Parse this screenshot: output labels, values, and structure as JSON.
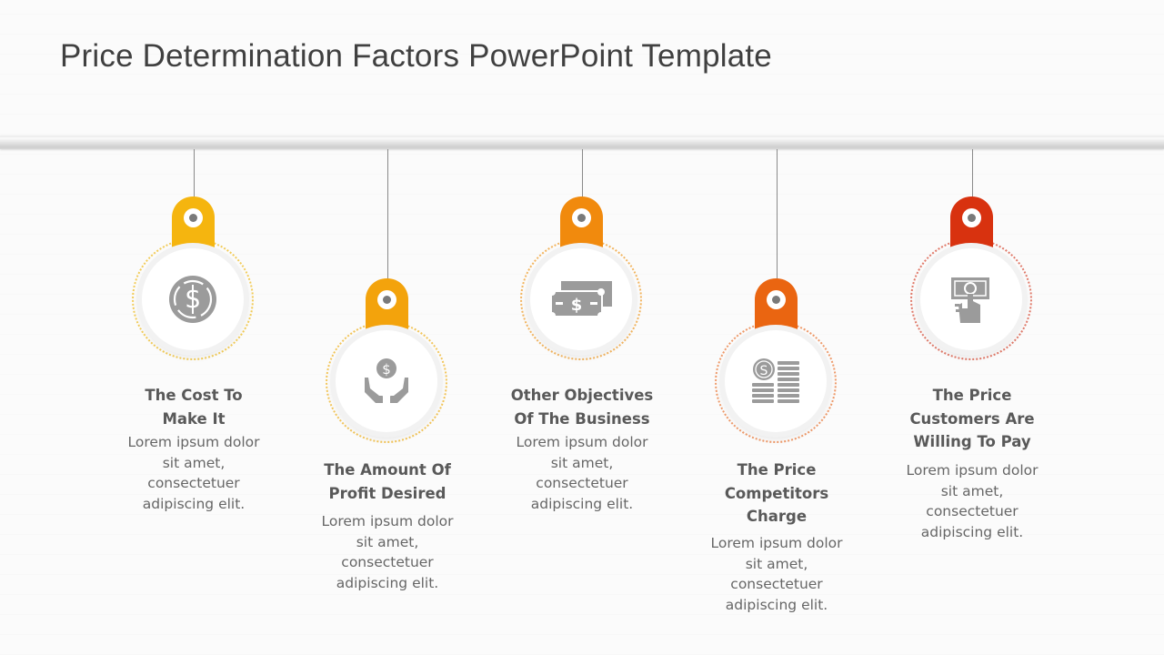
{
  "title": "Price Determination Factors PowerPoint Template",
  "factors": [
    {
      "heading": "The Cost To Make It",
      "heading_lines": [
        "The Cost To",
        "Make It"
      ],
      "body_lines": [
        "Lorem ipsum dolor",
        "sit amet,",
        "consectetuer",
        "adipiscing elit."
      ],
      "color": "#F5B50F",
      "ring_color": "#F2CC5A",
      "icon": "dollar-coin-icon"
    },
    {
      "heading": "The Amount Of Profit Desired",
      "heading_lines": [
        "The Amount Of",
        "Profit Desired"
      ],
      "body_lines": [
        "Lorem ipsum dolor",
        "sit amet,",
        "consectetuer",
        "adipiscing elit."
      ],
      "color": "#F3A30C",
      "ring_color": "#F2C55A",
      "icon": "hands-holding-coin-icon"
    },
    {
      "heading": "Other Objectives Of The Business",
      "heading_lines": [
        "Other Objectives",
        "Of The Business"
      ],
      "body_lines": [
        "Lorem ipsum dolor",
        "sit amet,",
        "consectetuer",
        "adipiscing elit."
      ],
      "color": "#F18A0D",
      "ring_color": "#F2B560",
      "icon": "banknotes-icon"
    },
    {
      "heading": "The Price Competitors Charge",
      "heading_lines": [
        "The Price",
        "Competitors",
        "Charge"
      ],
      "body_lines": [
        "Lorem ipsum dolor",
        "sit amet,",
        "consectetuer",
        "adipiscing elit."
      ],
      "color": "#EA6511",
      "ring_color": "#EE9A6A",
      "icon": "coin-stacks-icon"
    },
    {
      "heading": "The Price Customers Are Willing To Pay",
      "heading_lines": [
        "The Price",
        "Customers Are",
        "Willing To Pay"
      ],
      "body_lines": [
        "Lorem ipsum dolor",
        "sit amet,",
        "consectetuer",
        "adipiscing elit."
      ],
      "color": "#D8320F",
      "ring_color": "#E07A6A",
      "icon": "hand-with-bill-icon"
    }
  ]
}
